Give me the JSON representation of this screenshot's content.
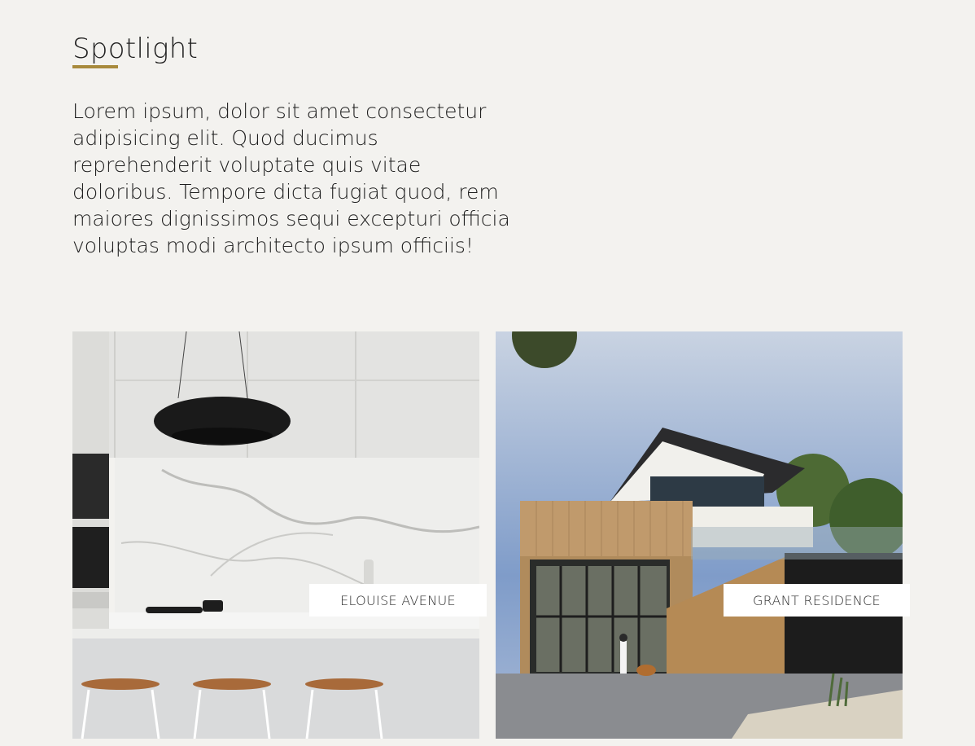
{
  "section": {
    "title": "Spotlight",
    "accent_color": "#a88a3c",
    "intro": "Lorem ipsum, dolor sit amet consectetur adipisicing elit. Quod ducimus reprehenderit voluptate quis vitae doloribus. Tempore dicta fugiat quod, rem maiores dignissimos sequi excepturi officia voluptas modi architecto ipsum officiis!"
  },
  "projects": [
    {
      "label": "ELOUISE AVENUE",
      "image": "kitchen-interior-photo"
    },
    {
      "label": "GRANT RESIDENCE",
      "image": "modern-house-exterior-photo"
    }
  ]
}
